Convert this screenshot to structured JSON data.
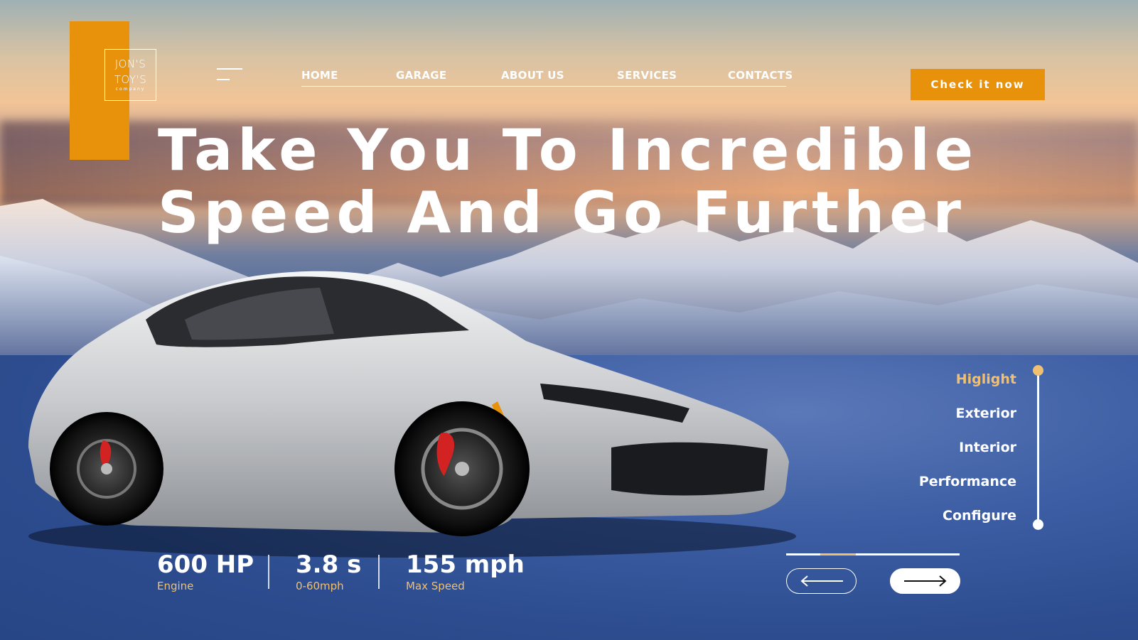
{
  "brand": {
    "line1": "JON'S",
    "line2": "TOY'S",
    "line3": "company"
  },
  "nav": {
    "items": [
      "HOME",
      "GARAGE",
      "ABOUT US",
      "SERVICES",
      "CONTACTS"
    ]
  },
  "cta": {
    "label": "Check it now"
  },
  "hero": {
    "line1": "Take You To Incredible",
    "line2": "Speed And Go Further"
  },
  "side_menu": {
    "items": [
      "Higlight",
      "Exterior",
      "Interior",
      "Performance",
      "Configure"
    ],
    "active": "Higlight"
  },
  "stats": [
    {
      "value": "600 HP",
      "label": "Engine"
    },
    {
      "value": "3.8 s",
      "label": "0-60mph"
    },
    {
      "value": "155 mph",
      "label": "Max Speed"
    }
  ],
  "colors": {
    "accent": "#e8920b",
    "highlight": "#f0c070",
    "text": "#ffffff"
  },
  "icons": {
    "menu": "hamburger-icon",
    "prev": "arrow-left-icon",
    "next": "arrow-right-icon"
  }
}
